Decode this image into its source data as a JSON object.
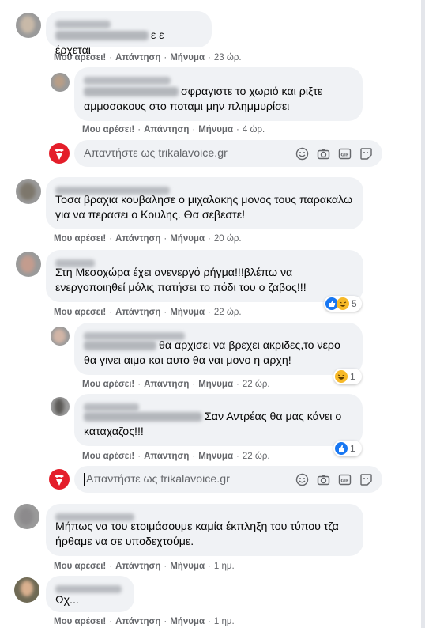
{
  "actions": {
    "like": "Μου αρέσει!",
    "reply": "Απάντηση",
    "message": "Μήνυμα"
  },
  "reply_placeholder": "Απαντήστε ως trikalavoice.gr",
  "comments": [
    {
      "id": "c1",
      "text": "ε ε έρχεται",
      "time": "23 ώρ."
    },
    {
      "id": "r1",
      "text": "σφραγιστε το χωριό και ριξτε αμμοσακους στο ποταμι μην πλημμυρίσει",
      "time": "4 ώρ."
    },
    {
      "id": "c2",
      "text": "Τοσα βραχια κουβαλησε ο μιχαλακης μονος τους παρακαλω για να περασει ο Κουλης. Θα σεβεστε!",
      "time": "20 ώρ."
    },
    {
      "id": "c3",
      "text": "Στη Μεσοχώρα έχει ανενεργό ρήγμα!!!βλέπω να ενεργοποιηθεί μόλις πατήσει το πόδι του ο ζαβος!!!",
      "time": "22 ώρ.",
      "reactions": "5"
    },
    {
      "id": "r2",
      "text": "θα αρχισει να βρεχει ακριδες,το νερο θα γινει αιμα και αυτο θα ναι μονο η αρχη!",
      "time": "22 ώρ.",
      "reactions": "1"
    },
    {
      "id": "r3",
      "text": "Σαν Αντρέας θα μας κάνει ο καταχαζος!!!",
      "time": "22 ώρ.",
      "reactions": "1"
    },
    {
      "id": "c4",
      "text": "Μήπως να του ετοιμάσουμε καμία έκπληξη του τύπου τζα ήρθαμε να σε υποδεχτούμε.",
      "time": "1 ημ."
    },
    {
      "id": "c5",
      "text": "Ωχ...",
      "time": "1 ημ."
    }
  ],
  "icon_names": [
    "emoji-icon",
    "camera-icon",
    "gif-icon",
    "sticker-icon",
    "like-reaction-icon",
    "haha-reaction-icon"
  ],
  "colors": {
    "bubble": "#f0f2f5",
    "meta": "#65676b",
    "like": "#1877f2",
    "haha": "#f7b928",
    "logo": "#e41e2a"
  }
}
